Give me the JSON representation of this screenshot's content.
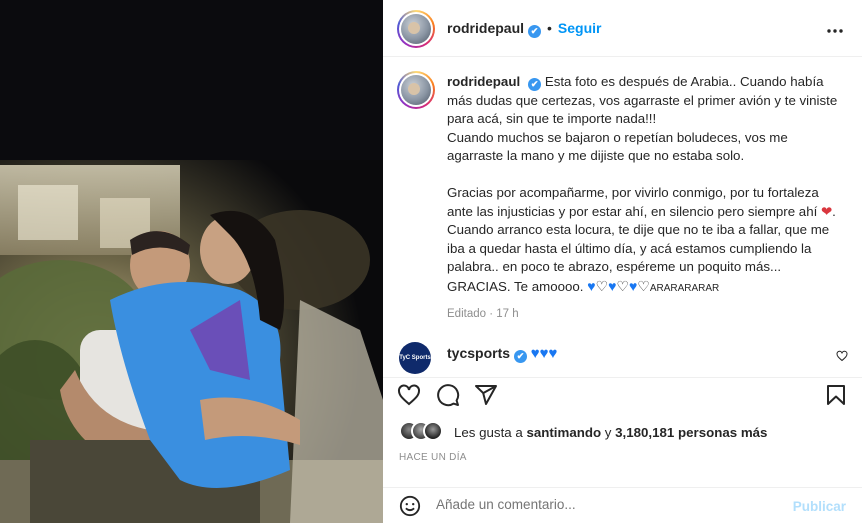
{
  "post": {
    "username": "rodridepaul",
    "follow_label": "Seguir",
    "dot": "•",
    "verified_mark": "✔"
  },
  "caption": {
    "username": "rodridepaul",
    "p1": "Esta foto es después de Arabia.. Cuando había más dudas que certezas, vos agarraste el primer avión y te viniste para acá, sin que te importe nada!!!",
    "p2": "Cuando muchos se bajaron o repetían boludeces, vos me agarraste la mano y me dijiste que no estaba solo.",
    "p3": "Gracias por acompañarme, por vivirlo conmigo, por tu fortaleza ante las injusticias y por estar ahí, en silencio pero siempre ahí",
    "p4": "Cuando arranco esta locura, te dije que no te iba a fallar, que me iba a quedar hasta el último día, y acá estamos cumpliendo la palabra.. en poco te abrazo, espéreme un poquito más...",
    "p5": "GRACIAS. Te amoooo.",
    "p5_trail": "ARARARARAR",
    "edited": "Editado",
    "edited_sep": "·",
    "edited_time": "17 h"
  },
  "comment": {
    "username": "tycsports",
    "avatar_text": "TyC Sports"
  },
  "likes": {
    "prefix": "Les gusta a",
    "user": "santimando",
    "middle": "y",
    "count": "3,180,181 personas más"
  },
  "time_ago": "HACE UN DÍA",
  "add_comment": {
    "placeholder": "Añade un comentario...",
    "publish": "Publicar"
  },
  "colors": {
    "accent_blue": "#0095f6",
    "verified_blue": "#3897f0",
    "publish_disabled": "#b2dffc"
  },
  "icons": {
    "more": "more-options-icon",
    "heart": "heart-icon",
    "comment": "comment-icon",
    "share": "share-icon",
    "save": "bookmark-icon",
    "emoji": "emoji-icon"
  }
}
